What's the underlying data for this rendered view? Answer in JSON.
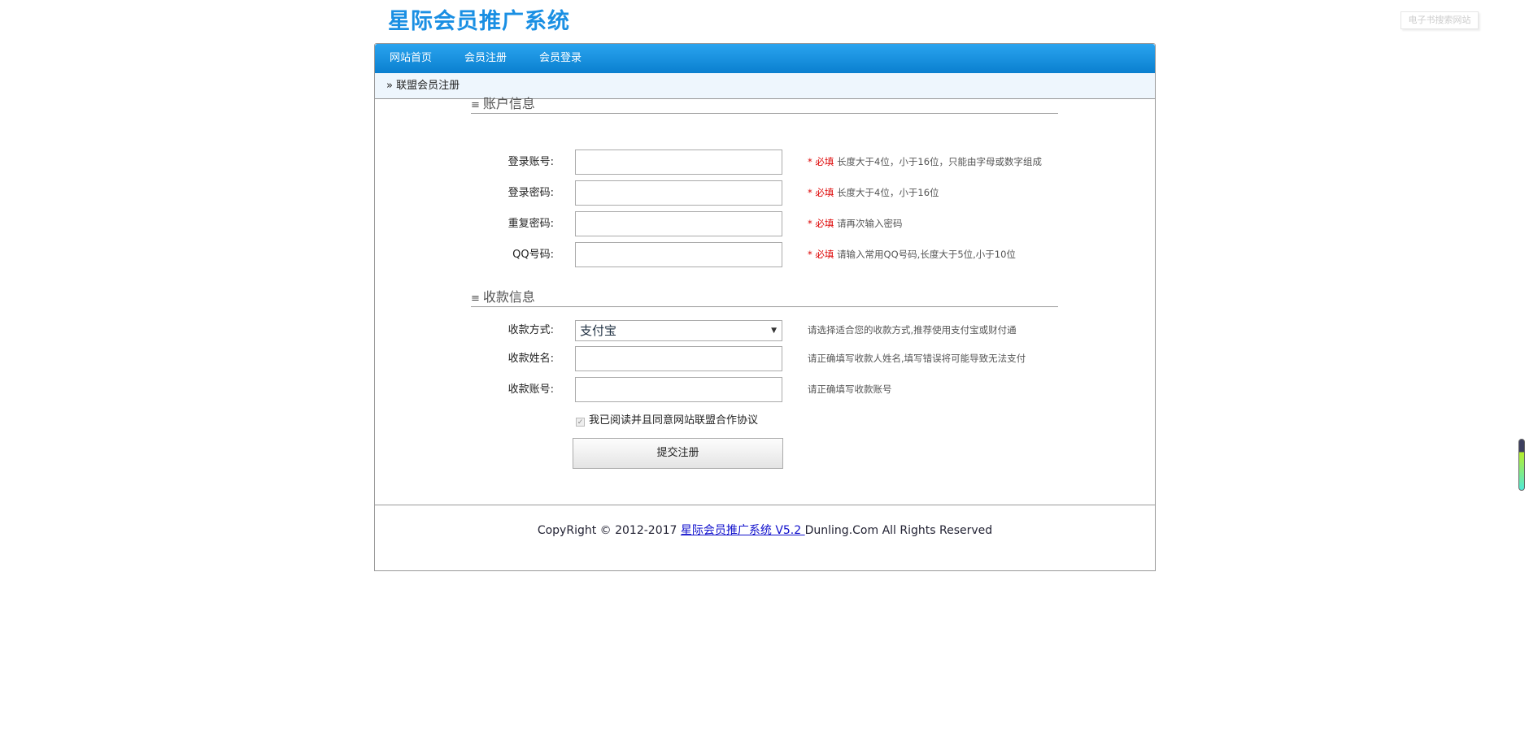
{
  "header": {
    "title": "星际会员推广系统",
    "watermark": "电子书搜索网站"
  },
  "nav": [
    "网站首页",
    "会员注册",
    "会员登录"
  ],
  "breadcrumb": {
    "icon": "»",
    "label": "联盟会员注册"
  },
  "sections": {
    "account": "账户信息",
    "payment": "收款信息",
    "icon": "≡"
  },
  "account_fields": [
    {
      "label": "登录账号:",
      "required": "* 必填",
      "hint": "长度大于4位，小于16位，只能由字母或数字组成",
      "value": ""
    },
    {
      "label": "登录密码:",
      "required": "* 必填",
      "hint": "长度大于4位，小于16位",
      "value": ""
    },
    {
      "label": "重复密码:",
      "required": "* 必填",
      "hint": "请再次输入密码",
      "value": ""
    },
    {
      "label": "QQ号码:",
      "required": "* 必填",
      "hint": "请输入常用QQ号码,长度大于5位,小于10位",
      "value": ""
    }
  ],
  "payment_fields": {
    "method": {
      "label": "收款方式:",
      "selected": "支付宝",
      "hint": "请选择适合您的收款方式,推荐使用支付宝或财付通"
    },
    "name": {
      "label": "收款姓名:",
      "hint": "请正确填写收款人姓名,填写错误将可能导致无法支付",
      "value": ""
    },
    "account": {
      "label": "收款账号:",
      "hint": "请正确填写收款账号",
      "value": ""
    }
  },
  "agreement": {
    "label": "我已阅读并且同意网站联盟合作协议",
    "checked": true
  },
  "submit_label": "提交注册",
  "footer": {
    "prefix": "CopyRight © 2012-2017 ",
    "link": "星际会员推广系统 V5.2 ",
    "suffix": "Dunling.Com All Rights Reserved"
  }
}
